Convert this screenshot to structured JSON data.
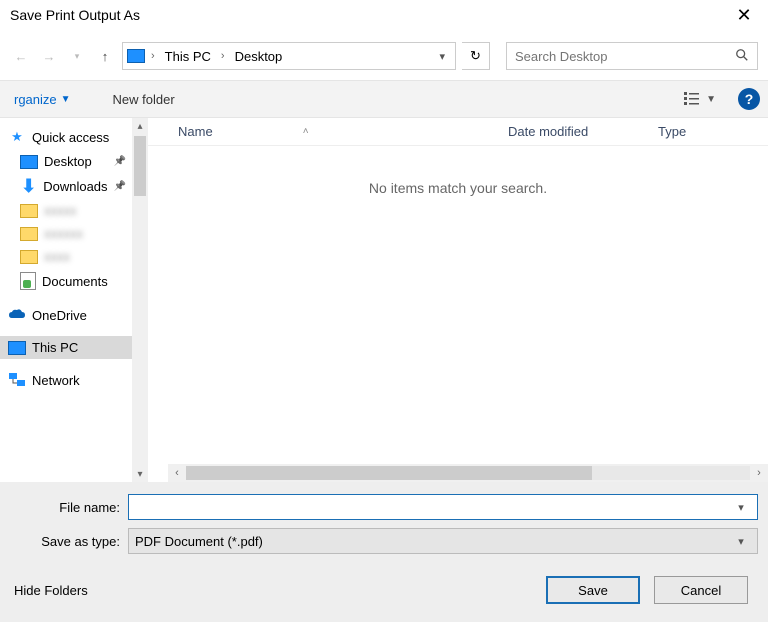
{
  "window": {
    "title": "Save Print Output As"
  },
  "nav": {
    "breadcrumb": [
      "This PC",
      "Desktop"
    ],
    "search_placeholder": "Search Desktop"
  },
  "toolbar": {
    "organize": "rganize",
    "new_folder": "New folder"
  },
  "sidebar": {
    "quick_access": "Quick access",
    "desktop": "Desktop",
    "downloads": "Downloads",
    "folder1": "xxxxx",
    "folder2": "xxxxxx",
    "folder3": "xxxx",
    "documents": "Documents",
    "onedrive": "OneDrive",
    "this_pc": "This PC",
    "network": "Network"
  },
  "columns": {
    "name": "Name",
    "date": "Date modified",
    "type": "Type"
  },
  "filelist": {
    "empty_message": "No items match your search."
  },
  "form": {
    "filename_label": "File name:",
    "filename_value": "",
    "type_label": "Save as type:",
    "type_value": "PDF Document (*.pdf)"
  },
  "footer": {
    "hide_folders": "Hide Folders",
    "save": "Save",
    "cancel": "Cancel"
  }
}
